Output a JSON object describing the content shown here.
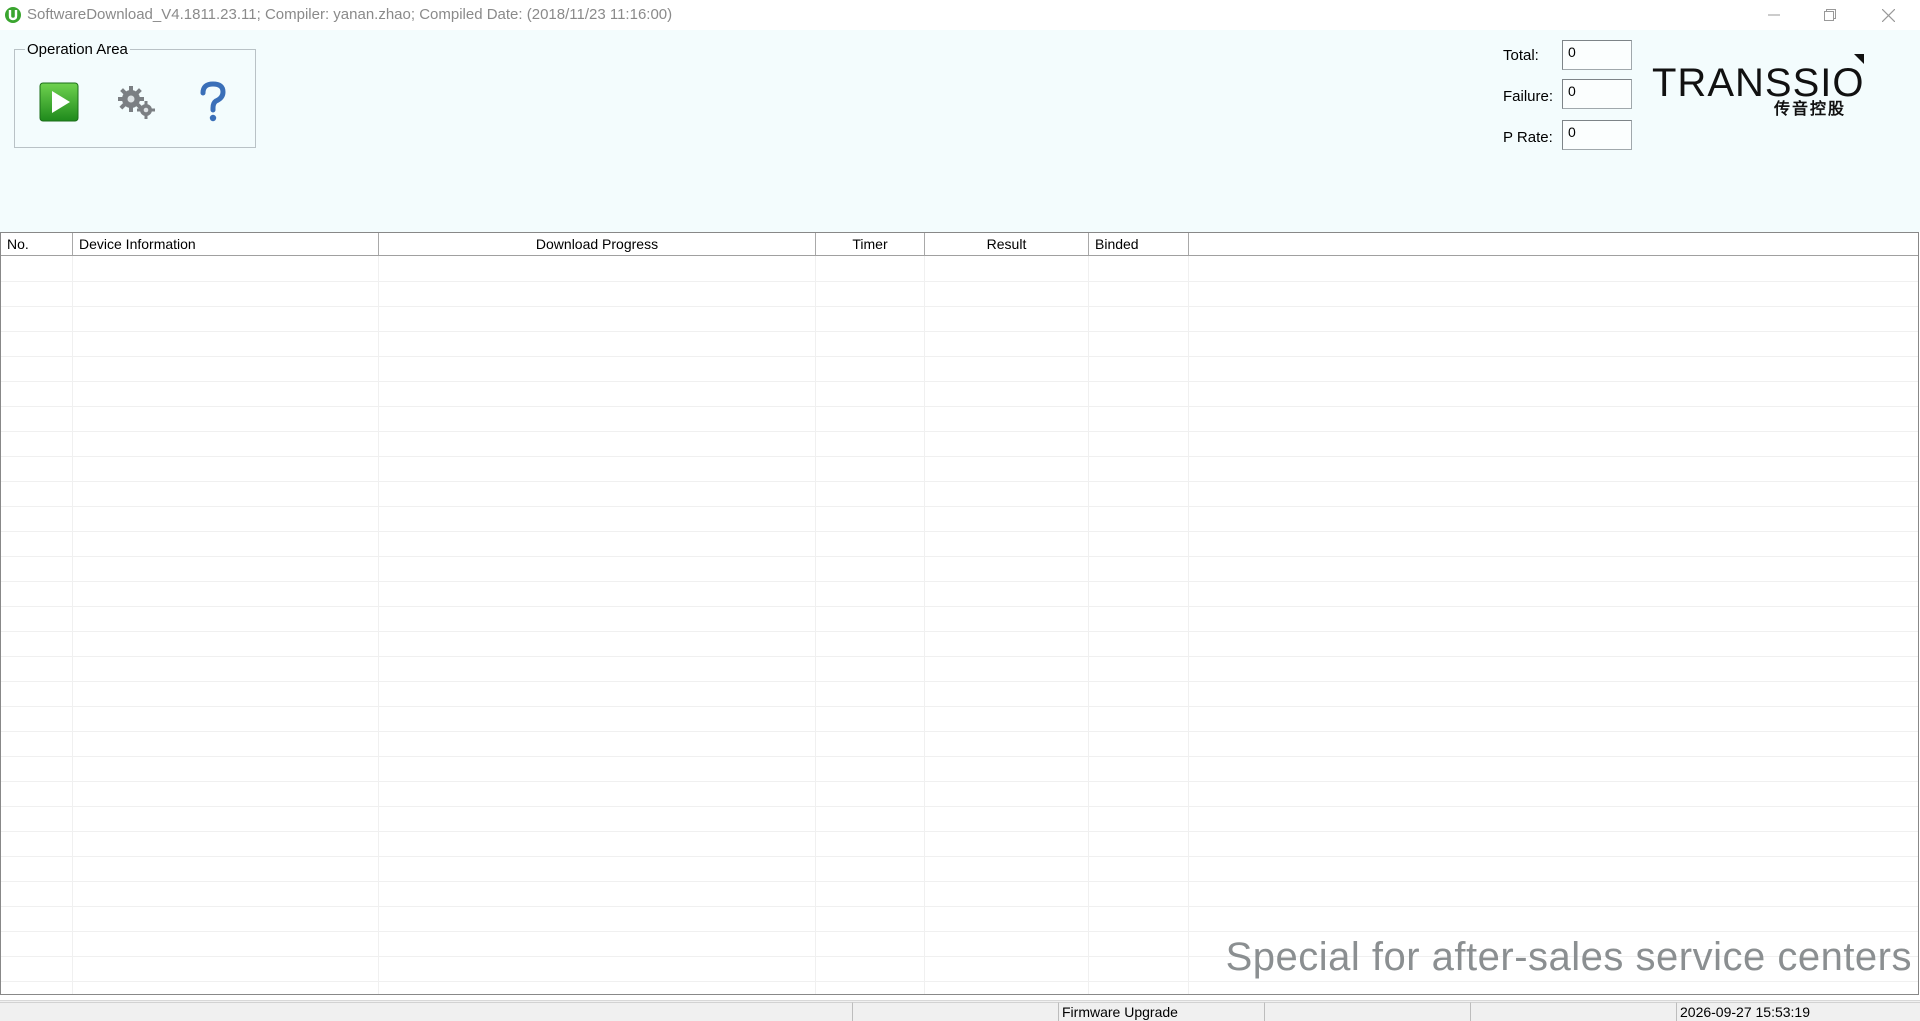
{
  "window": {
    "title": "SoftwareDownload_V4.1811.23.11; Compiler: yanan.zhao; Compiled Date: (2018/11/23 11:16:00)"
  },
  "operation_area": {
    "legend": "Operation Area",
    "buttons": [
      {
        "name": "start-download",
        "icon": "play-icon"
      },
      {
        "name": "settings",
        "icon": "gear-icon"
      },
      {
        "name": "help",
        "icon": "question-icon"
      }
    ]
  },
  "stats": {
    "total_label": "Total:",
    "total_value": "0",
    "failure_label": "Failure:",
    "failure_value": "0",
    "prate_label": "P Rate:",
    "prate_value": "0"
  },
  "logo": {
    "brand": "TRANSSION",
    "sub": "传音控股"
  },
  "table": {
    "columns": [
      "No.",
      "Device Information",
      "Download Progress",
      "Timer",
      "Result",
      "Binded"
    ],
    "rows": []
  },
  "watermark": "Special for after-sales service centers",
  "statusbar": {
    "mode": "Firmware Upgrade",
    "datetime": "2026-09-27 15:53:19"
  },
  "colors": {
    "panel_bg": "#f3fcfd",
    "play_green": "#3aa52f",
    "help_blue": "#3a6fb8"
  }
}
